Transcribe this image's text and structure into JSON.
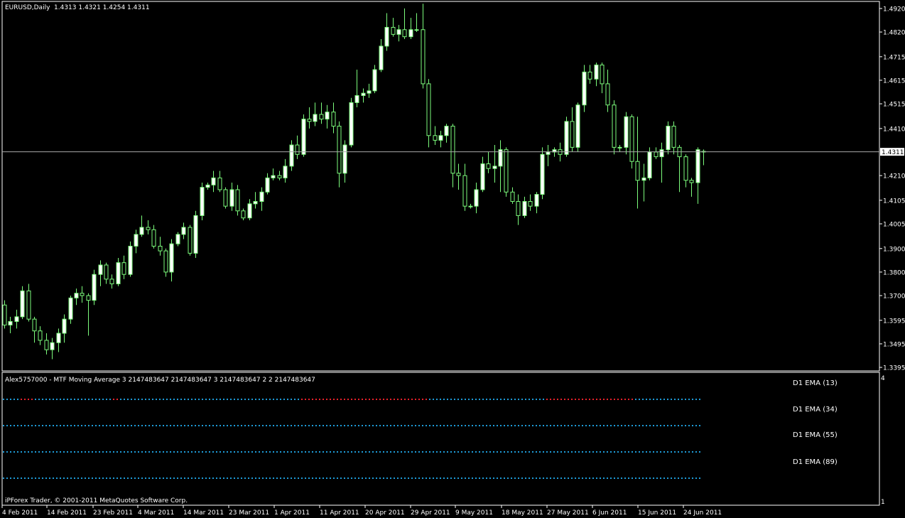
{
  "header": {
    "symbol_label": "EURUSD,Daily",
    "ohlc_label": "1.4313 1.4321 1.4254 1.4311"
  },
  "indicator": {
    "title": "Alex5757000 - MTF Moving Average 3 2147483647 2147483647 3 2147483647 2 2 2147483647",
    "legend": [
      {
        "name": "D1 EMA (13)",
        "color": "#1e9bd7"
      },
      {
        "name": "D1 EMA (34)",
        "color": "#e8212a"
      },
      {
        "name": "D1 EMA (55)",
        "color": "#e8212a"
      },
      {
        "name": "D1 EMA (89)",
        "color": "#1e9bd7"
      }
    ],
    "axis_top": "4",
    "axis_bottom": "1"
  },
  "footer": {
    "copyright": "iPForex Trader, © 2001-2011 MetaQuotes Software Corp."
  },
  "current_price_label": "1.4311",
  "colors": {
    "background": "#000000",
    "candle": "#7cfc7c",
    "bull_body": "#ffffff",
    "bear_body": "#000000",
    "axis": "#ffffff",
    "current_price_line": "#aaaaaa",
    "ema_up": "#1e9bd7",
    "ema_down": "#e8212a"
  },
  "chart_data": {
    "type": "candlestick",
    "symbol": "EURUSD",
    "timeframe": "Daily",
    "ylim": [
      1.338,
      1.495
    ],
    "y_ticks": [
      "1.4920",
      "1.4820",
      "1.4715",
      "1.4615",
      "1.4515",
      "1.4410",
      "1.4311",
      "1.4210",
      "1.4105",
      "1.4005",
      "1.3900",
      "1.3800",
      "1.3700",
      "1.3595",
      "1.3495",
      "1.3395"
    ],
    "x_tick_labels": [
      "4 Feb 2011",
      "14 Feb 2011",
      "23 Feb 2011",
      "4 Mar 2011",
      "14 Mar 2011",
      "23 Mar 2011",
      "1 Apr 2011",
      "11 Apr 2011",
      "20 Apr 2011",
      "29 Apr 2011",
      "9 May 2011",
      "18 May 2011",
      "27 May 2011",
      "6 Jun 2011",
      "15 Jun 2011",
      "24 Jun 2011"
    ],
    "candles": [
      [
        1.366,
        1.368,
        1.356,
        1.3575
      ],
      [
        1.3575,
        1.361,
        1.354,
        1.359
      ],
      [
        1.359,
        1.364,
        1.356,
        1.361
      ],
      [
        1.361,
        1.374,
        1.36,
        1.372
      ],
      [
        1.372,
        1.375,
        1.359,
        1.36
      ],
      [
        1.36,
        1.361,
        1.35,
        1.355
      ],
      [
        1.355,
        1.357,
        1.349,
        1.351
      ],
      [
        1.351,
        1.354,
        1.345,
        1.347
      ],
      [
        1.347,
        1.352,
        1.343,
        1.35
      ],
      [
        1.35,
        1.356,
        1.346,
        1.354
      ],
      [
        1.354,
        1.362,
        1.35,
        1.36
      ],
      [
        1.36,
        1.37,
        1.358,
        1.369
      ],
      [
        1.369,
        1.373,
        1.366,
        1.371
      ],
      [
        1.371,
        1.374,
        1.367,
        1.37
      ],
      [
        1.37,
        1.371,
        1.353,
        1.368
      ],
      [
        1.368,
        1.381,
        1.366,
        1.379
      ],
      [
        1.379,
        1.385,
        1.374,
        1.383
      ],
      [
        1.383,
        1.384,
        1.375,
        1.377
      ],
      [
        1.377,
        1.379,
        1.373,
        1.375
      ],
      [
        1.375,
        1.386,
        1.374,
        1.384
      ],
      [
        1.384,
        1.387,
        1.377,
        1.379
      ],
      [
        1.379,
        1.393,
        1.378,
        1.391
      ],
      [
        1.391,
        1.398,
        1.388,
        1.396
      ],
      [
        1.396,
        1.404,
        1.395,
        1.399
      ],
      [
        1.399,
        1.402,
        1.396,
        1.398
      ],
      [
        1.398,
        1.4,
        1.39,
        1.391
      ],
      [
        1.391,
        1.395,
        1.387,
        1.389
      ],
      [
        1.389,
        1.39,
        1.378,
        1.38
      ],
      [
        1.38,
        1.394,
        1.376,
        1.392
      ],
      [
        1.392,
        1.397,
        1.391,
        1.396
      ],
      [
        1.396,
        1.401,
        1.394,
        1.399
      ],
      [
        1.399,
        1.4,
        1.387,
        1.388
      ],
      [
        1.388,
        1.406,
        1.386,
        1.404
      ],
      [
        1.404,
        1.418,
        1.402,
        1.416
      ],
      [
        1.416,
        1.418,
        1.415,
        1.417
      ],
      [
        1.417,
        1.423,
        1.414,
        1.42
      ],
      [
        1.42,
        1.423,
        1.414,
        1.415
      ],
      [
        1.415,
        1.416,
        1.407,
        1.408
      ],
      [
        1.408,
        1.418,
        1.406,
        1.415
      ],
      [
        1.415,
        1.417,
        1.404,
        1.406
      ],
      [
        1.406,
        1.407,
        1.402,
        1.403
      ],
      [
        1.403,
        1.411,
        1.402,
        1.409
      ],
      [
        1.409,
        1.414,
        1.407,
        1.41
      ],
      [
        1.41,
        1.416,
        1.406,
        1.414
      ],
      [
        1.414,
        1.422,
        1.413,
        1.42
      ],
      [
        1.42,
        1.424,
        1.419,
        1.421
      ],
      [
        1.421,
        1.423,
        1.419,
        1.42
      ],
      [
        1.42,
        1.428,
        1.418,
        1.425
      ],
      [
        1.425,
        1.436,
        1.423,
        1.434
      ],
      [
        1.434,
        1.438,
        1.428,
        1.43
      ],
      [
        1.43,
        1.447,
        1.429,
        1.445
      ],
      [
        1.445,
        1.45,
        1.441,
        1.444
      ],
      [
        1.444,
        1.452,
        1.442,
        1.447
      ],
      [
        1.447,
        1.452,
        1.443,
        1.445
      ],
      [
        1.445,
        1.451,
        1.441,
        1.448
      ],
      [
        1.448,
        1.452,
        1.439,
        1.442
      ],
      [
        1.442,
        1.444,
        1.416,
        1.422
      ],
      [
        1.422,
        1.436,
        1.418,
        1.434
      ],
      [
        1.434,
        1.454,
        1.433,
        1.452
      ],
      [
        1.452,
        1.466,
        1.45,
        1.455
      ],
      [
        1.455,
        1.458,
        1.452,
        1.456
      ],
      [
        1.456,
        1.46,
        1.454,
        1.457
      ],
      [
        1.457,
        1.468,
        1.456,
        1.466
      ],
      [
        1.466,
        1.479,
        1.465,
        1.476
      ],
      [
        1.476,
        1.49,
        1.474,
        1.484
      ],
      [
        1.484,
        1.488,
        1.48,
        1.481
      ],
      [
        1.481,
        1.485,
        1.478,
        1.483
      ],
      [
        1.483,
        1.492,
        1.479,
        1.48
      ],
      [
        1.48,
        1.488,
        1.479,
        1.483
      ],
      [
        1.483,
        1.49,
        1.482,
        1.483
      ],
      [
        1.483,
        1.494,
        1.458,
        1.46
      ],
      [
        1.46,
        1.462,
        1.433,
        1.438
      ],
      [
        1.438,
        1.442,
        1.434,
        1.436
      ],
      [
        1.436,
        1.44,
        1.433,
        1.438
      ],
      [
        1.438,
        1.443,
        1.435,
        1.442
      ],
      [
        1.442,
        1.443,
        1.416,
        1.422
      ],
      [
        1.422,
        1.426,
        1.415,
        1.421
      ],
      [
        1.421,
        1.426,
        1.406,
        1.408
      ],
      [
        1.408,
        1.409,
        1.407,
        1.408
      ],
      [
        1.408,
        1.418,
        1.405,
        1.415
      ],
      [
        1.415,
        1.429,
        1.414,
        1.426
      ],
      [
        1.426,
        1.431,
        1.422,
        1.424
      ],
      [
        1.424,
        1.434,
        1.418,
        1.425
      ],
      [
        1.425,
        1.436,
        1.414,
        1.432
      ],
      [
        1.432,
        1.433,
        1.412,
        1.414
      ],
      [
        1.414,
        1.416,
        1.409,
        1.41
      ],
      [
        1.41,
        1.413,
        1.4,
        1.404
      ],
      [
        1.404,
        1.412,
        1.403,
        1.41
      ],
      [
        1.41,
        1.413,
        1.406,
        1.408
      ],
      [
        1.408,
        1.414,
        1.405,
        1.413
      ],
      [
        1.413,
        1.433,
        1.411,
        1.43
      ],
      [
        1.43,
        1.434,
        1.425,
        1.431
      ],
      [
        1.431,
        1.433,
        1.429,
        1.432
      ],
      [
        1.432,
        1.435,
        1.427,
        1.43
      ],
      [
        1.43,
        1.446,
        1.429,
        1.444
      ],
      [
        1.444,
        1.45,
        1.431,
        1.433
      ],
      [
        1.433,
        1.452,
        1.431,
        1.451
      ],
      [
        1.451,
        1.468,
        1.448,
        1.465
      ],
      [
        1.465,
        1.468,
        1.46,
        1.462
      ],
      [
        1.462,
        1.469,
        1.459,
        1.468
      ],
      [
        1.468,
        1.469,
        1.456,
        1.46
      ],
      [
        1.46,
        1.466,
        1.448,
        1.451
      ],
      [
        1.451,
        1.453,
        1.43,
        1.433
      ],
      [
        1.433,
        1.434,
        1.431,
        1.433
      ],
      [
        1.433,
        1.448,
        1.43,
        1.446
      ],
      [
        1.446,
        1.447,
        1.424,
        1.427
      ],
      [
        1.427,
        1.446,
        1.407,
        1.419
      ],
      [
        1.419,
        1.426,
        1.41,
        1.42
      ],
      [
        1.42,
        1.433,
        1.419,
        1.431
      ],
      [
        1.431,
        1.433,
        1.428,
        1.429
      ],
      [
        1.429,
        1.435,
        1.418,
        1.432
      ],
      [
        1.432,
        1.444,
        1.43,
        1.442
      ],
      [
        1.442,
        1.444,
        1.43,
        1.433
      ],
      [
        1.433,
        1.434,
        1.414,
        1.429
      ],
      [
        1.429,
        1.43,
        1.416,
        1.419
      ],
      [
        1.419,
        1.42,
        1.412,
        1.418
      ],
      [
        1.418,
        1.433,
        1.409,
        1.432
      ],
      [
        1.4313,
        1.4321,
        1.4254,
        1.4311
      ]
    ],
    "ema_lines": [
      {
        "name": "D1 EMA (13)",
        "color_pattern": "BBBBBRRRRBBBBBBBBBBBBBBBBBBBBBBBRRBBBBBBBBBBBBBBBBBBBBBBBBBBBBBBBBBBBBBBBBBBBBBBBBBBBBBRRRRRRRRRRRRRRRRRRRRRRRRRRRRRRRRRRRRRBBBBBBBBBBBBBBBBBBBBBBBBBBBBBBBBBBBRRRRRRRRRRRRRRRRRRRRRRRRRRBBBBBBBBBBBBBBBBBBBB"
      },
      {
        "name": "D1 EMA (34)",
        "color_pattern": "BBBBBBBBBBBBBBBBBBBBBBBBBBBBBBBBBBBBBBBBBBBBBBBBBBBBBBBBBBBBBBBBBBBBBBBBBBBBBBBBBBBBBBBBBBBBBBBBBBBBBBBBBBBBBBBBBBBBBBBBBBBBBBBBBBBBBBBBBBBBBBBBBBBBBBBBBBBBBBBBBBBBBBBBBBBBBBBBBBBBBBBBBBBBBBBBBBBBBBBBBBBBBBBBBBBBBBBBBBBBBBBBBB"
      },
      {
        "name": "D1 EMA (55)",
        "color_pattern": "BBBBBBBBBBBBBBBBBBBBBBBBBBBBBBBBBBBBBBBBBBBBBBBBBBBBBBBBBBBBBBBBBBBBBBBBBBBBBBBBBBBBBBBBBBBBBBBBBBBBBBBBBBBBBBBBBBBBBBBBBBBBBBBBBBBBBBBBBBBBBBBBBBBBBBBBBBBBBBBBBBBBBBBBBBBBBBBBBBBBBBBBBBBBBBBBBBBBBBBBBBBBBBBBBBBBBBBBBBBBBBBBBB"
      },
      {
        "name": "D1 EMA (89)",
        "color_pattern": "BBBBBBBBBBBBBBBBBBBBBBBBBBBBBBBBBBBBBBBBBBBBBBBBBBBBBBBBBBBBBBBBBBBBBBBBBBBBBBBBBBBBBBBBBBBBBBBBBBBBBBBBBBBBBBBBBBBBBBBBBBBBBBBBBBBBBBBBBBBBBBBBBBBBBBBBBBBBBBBBBBBBBBBBBBBBBBBBBBBBBBBBBBBBBBBBBBBBBBBBBBBBBBBBBBBBBBBBBBBBBBBBBB"
      }
    ]
  }
}
